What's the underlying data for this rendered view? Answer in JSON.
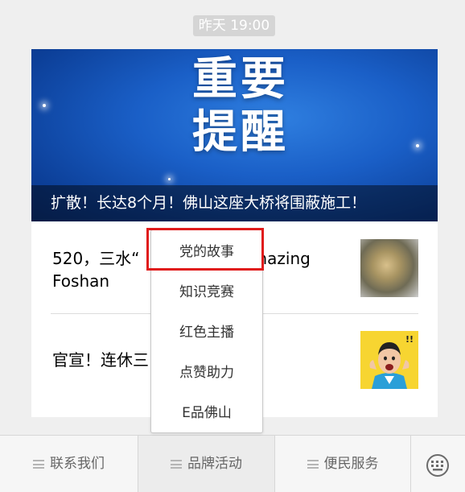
{
  "chat": {
    "timestamp": "昨天 19:00"
  },
  "news_card": {
    "banner": {
      "title_line1": "重要",
      "title_line2": "提醒",
      "caption": "扩散！长达8个月！佛山这座大桥将围蔽施工！"
    },
    "articles": [
      {
        "title_left": "520，三水“",
        "title_right": "Amazing",
        "title_line2": "Foshan"
      },
      {
        "title_left": "官宣！连休三"
      }
    ]
  },
  "popup_menu": {
    "items": [
      {
        "label": "党的故事"
      },
      {
        "label": "知识竞赛"
      },
      {
        "label": "红色主播"
      },
      {
        "label": "点赞助力"
      },
      {
        "label": "E品佛山"
      }
    ]
  },
  "bottom_menu": {
    "items": [
      {
        "label": "联系我们"
      },
      {
        "label": "品牌活动"
      },
      {
        "label": "便民服务"
      }
    ],
    "keyboard_icon": "keyboard-icon"
  },
  "colors": {
    "highlight": "#e01b1b",
    "banner_blue": "#1a5fc7"
  }
}
